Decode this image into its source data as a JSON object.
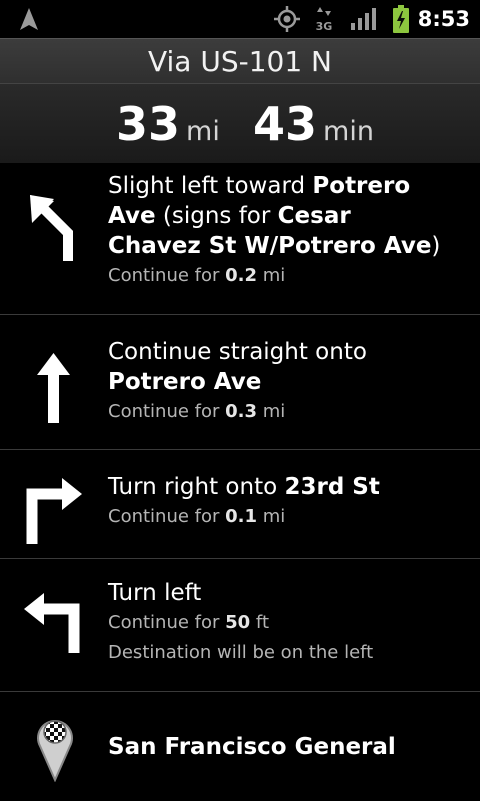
{
  "statusbar": {
    "network_label": "3G",
    "time": "8:53",
    "icons": [
      "navigation-arrow-icon",
      "gps-icon",
      "network-3g-icon",
      "signal-icon",
      "battery-charging-icon"
    ]
  },
  "route": {
    "via": "Via US-101 N",
    "distance_value": "33",
    "distance_unit": "mi",
    "time_value": "43",
    "time_unit": "min"
  },
  "steps": [
    {
      "icon": "slight-left-arrow-icon",
      "pre": "Slight left toward ",
      "bold1": "Potrero Ave",
      "mid": " (signs for ",
      "bold2": "Cesar Chavez St W/Potrero Ave",
      "post": ")",
      "continue_label": "Continue for ",
      "continue_value": "0.2",
      "continue_unit": " mi"
    },
    {
      "icon": "straight-arrow-icon",
      "pre": "Continue straight onto ",
      "bold1": "Potrero Ave",
      "continue_label": "Continue for ",
      "continue_value": "0.3",
      "continue_unit": " mi"
    },
    {
      "icon": "turn-right-arrow-icon",
      "pre": "Turn right onto ",
      "bold1": "23rd St",
      "continue_label": "Continue for ",
      "continue_value": "0.1",
      "continue_unit": " mi"
    },
    {
      "icon": "turn-left-arrow-icon",
      "pre": "Turn left",
      "continue_label": "Continue for ",
      "continue_value": "50",
      "continue_unit": " ft",
      "note": "Destination will be on the left"
    }
  ],
  "destination": {
    "icon": "checkered-flag-pin-icon",
    "name": "San Francisco General"
  },
  "colors": {
    "background": "#000000",
    "header": "#333333",
    "battery": "#8dc63f",
    "divider": "#3a3a3a",
    "secondary_text": "#b5b5b5"
  }
}
